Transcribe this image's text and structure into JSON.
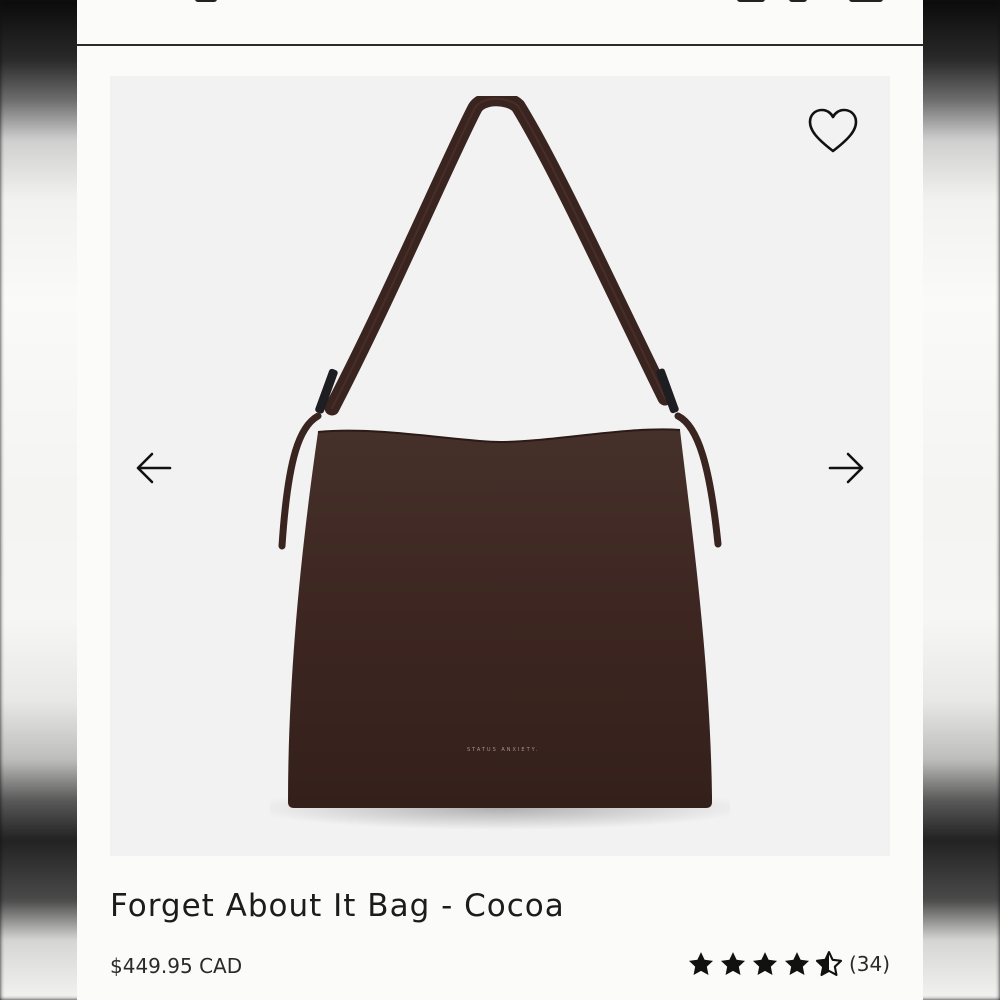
{
  "product": {
    "title": "Forget About It Bag - Cocoa",
    "price": "$449.95 CAD",
    "brand_stamp": "STATUS ANXIETY.",
    "rating_value": 4.5,
    "rating_max": 5,
    "review_count": "(34)"
  },
  "gallery": {
    "prev_icon": "arrow-left-icon",
    "next_icon": "arrow-right-icon",
    "wishlist_icon": "heart-outline-icon",
    "bag_color": "#3d2620",
    "background_color": "#f2f2f2"
  },
  "colors": {
    "text": "#1c1c1c",
    "star": "#111111"
  }
}
